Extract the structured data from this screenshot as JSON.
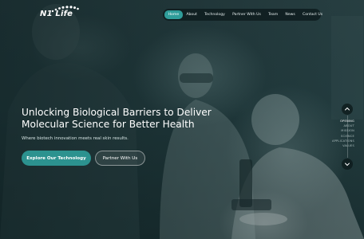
{
  "brand": {
    "name": "N1 Life"
  },
  "nav": {
    "items": [
      {
        "label": "Home",
        "active": true
      },
      {
        "label": "About",
        "active": false
      },
      {
        "label": "Technology",
        "active": false
      },
      {
        "label": "Partner With Us",
        "active": false
      },
      {
        "label": "Team",
        "active": false
      },
      {
        "label": "News",
        "active": false
      },
      {
        "label": "Contact Us",
        "active": false
      }
    ]
  },
  "hero": {
    "headline_line1": "Unlocking Biological Barriers to Deliver",
    "headline_line2": "Molecular Science for Better Health",
    "subline": "Where biotech innovation meets real skin results.",
    "primary_button": "Explore Our Technology",
    "secondary_button": "Partner With Us"
  },
  "section_nav": {
    "items": [
      {
        "label": "Opening",
        "active": true
      },
      {
        "label": "About",
        "active": false
      },
      {
        "label": "Mission",
        "active": false
      },
      {
        "label": "Science",
        "active": false
      },
      {
        "label": "Applications",
        "active": false
      },
      {
        "label": "Values",
        "active": false
      }
    ],
    "up_icon": "chevron-up-icon",
    "down_icon": "chevron-down-icon"
  },
  "colors": {
    "accent": "#2f9d9a",
    "nav_background": "#0e1c1e",
    "hero_tint": "#274245"
  }
}
